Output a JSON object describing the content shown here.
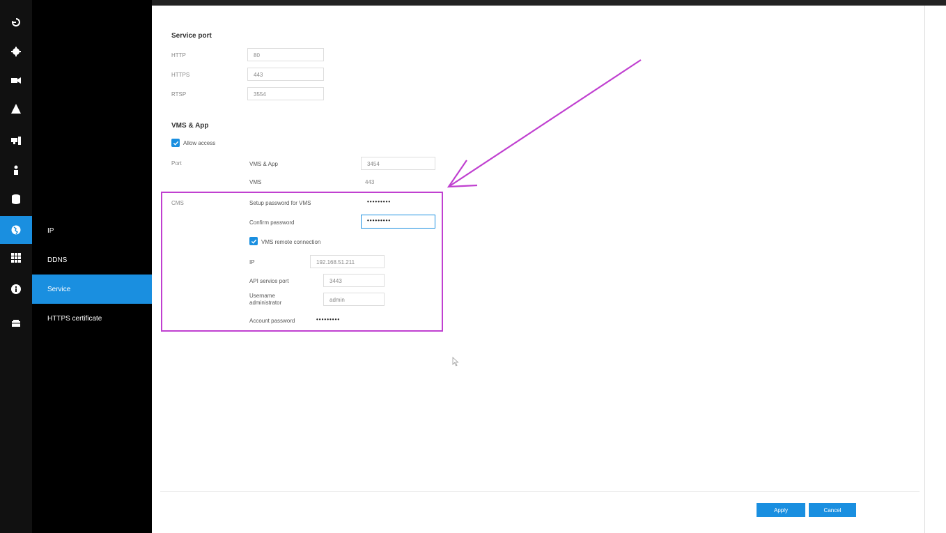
{
  "submenu": {
    "items": [
      {
        "label": "IP"
      },
      {
        "label": "DDNS"
      },
      {
        "label": "Service"
      },
      {
        "label": "HTTPS certificate"
      }
    ]
  },
  "service_port": {
    "title": "Service port",
    "http_label": "HTTP",
    "http_value": "80",
    "https_label": "HTTPS",
    "https_value": "443",
    "rtsp_label": "RTSP",
    "rtsp_value": "3554"
  },
  "vms_app": {
    "title": "VMS & App",
    "allow_access_label": "Allow access",
    "port_label": "Port",
    "port_vms_app_label": "VMS & App",
    "port_vms_app_value": "3454",
    "port_vms_label": "VMS",
    "port_vms_value": "443"
  },
  "cms": {
    "label": "CMS",
    "setup_password_label": "Setup password for VMS",
    "setup_password_value": "•••••••••",
    "confirm_password_label": "Confirm password",
    "confirm_password_value": "•••••••••",
    "remote_connection_label": "VMS remote connection",
    "ip_label": "IP",
    "ip_value": "192.168.51.211",
    "api_port_label": "API service port",
    "api_port_value": "3443",
    "username_label_1": "Username",
    "username_label_2": "administrator",
    "username_value": "admin",
    "account_password_label": "Account password",
    "account_password_value": "•••••••••"
  },
  "footer": {
    "apply_label": "Apply",
    "cancel_label": "Cancel"
  },
  "colors": {
    "accent": "#1a8fe0",
    "annotation": "#c040d0"
  }
}
